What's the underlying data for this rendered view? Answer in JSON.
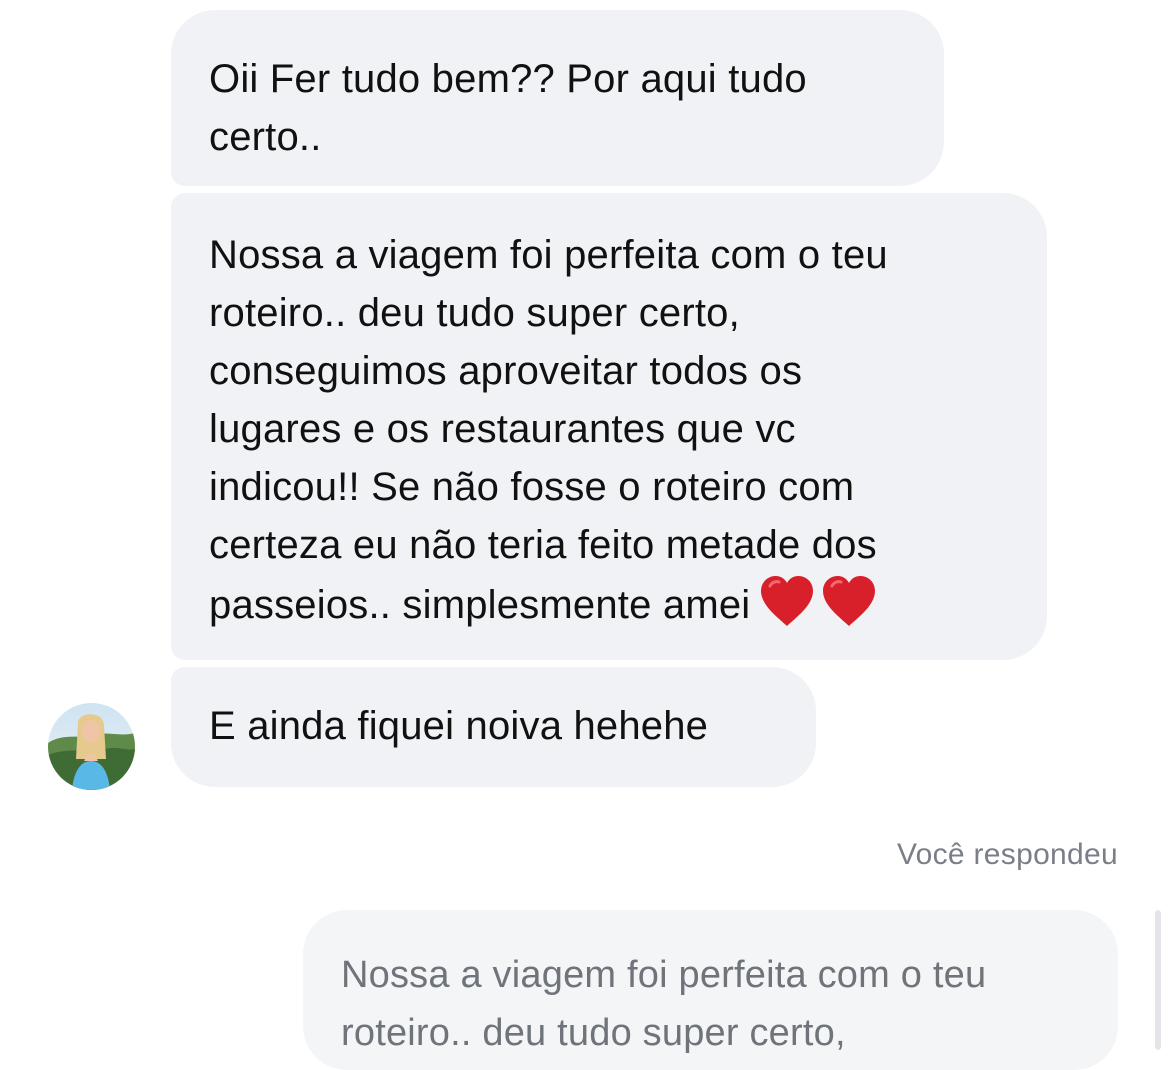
{
  "thread": {
    "messages": [
      {
        "text": "Oii Fer tudo bem?? Por aqui tudo\ncerto.."
      },
      {
        "text": "Nossa a viagem foi perfeita com o teu\nroteiro.. deu tudo super certo,\nconseguimos aproveitar todos os\nlugares e os restaurantes que vc\nindicou!! Se não fosse o roteiro com\ncerteza eu não teria feito metade dos\npasseios.. simplesmente amei",
        "emoji": "red-heart-icon x2"
      },
      {
        "text": "E ainda fiquei noiva hehehe"
      }
    ],
    "reply": {
      "label": "Você respondeu",
      "quoted_text": "Nossa a viagem foi perfeita com o teu\nroteiro.. deu tudo super certo,"
    }
  },
  "colors": {
    "incoming_bubble": "#f1f2f5",
    "reply_bubble": "#f4f5f7",
    "text": "#111111",
    "muted_text": "#7a7f87",
    "heart": "#d8202b"
  }
}
